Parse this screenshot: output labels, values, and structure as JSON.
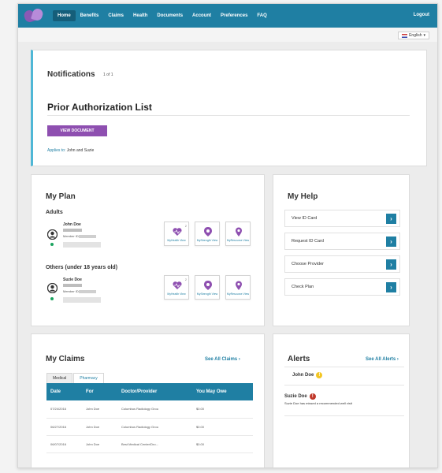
{
  "nav": {
    "items": [
      "Home",
      "Benefits",
      "Claims",
      "Health",
      "Documents",
      "Account",
      "Preferences",
      "FAQ"
    ],
    "active": "Home",
    "logout": "Logout"
  },
  "language": {
    "selected": "English"
  },
  "notifications": {
    "title": "Notifications",
    "count": "1 of 1",
    "item_title": "Prior Authorization List",
    "button": "VIEW DOCUMENT",
    "applies_label": "Applies to:",
    "applies_value": "John and Suzie"
  },
  "plan": {
    "title": "My Plan",
    "adults_heading": "Adults",
    "others_heading": "Others (under 18 years old)",
    "members": [
      {
        "name": "John Doe",
        "member_label": "Member ID:"
      },
      {
        "name": "Suzie Doe",
        "member_label": "Member ID:"
      }
    ],
    "tiles": [
      "MyHealth View",
      "MyStrength View",
      "MyResource View"
    ],
    "tile_badge": "2"
  },
  "help": {
    "title": "My Help",
    "items": [
      "View ID Card",
      "Request ID Card",
      "Choose Provider",
      "Check Plan"
    ]
  },
  "claims": {
    "title": "My Claims",
    "see_all": "See All Claims",
    "tabs": [
      "Medical",
      "Pharmacy"
    ],
    "columns": [
      "Date",
      "For",
      "Doctor/Provider",
      "You May Owe"
    ],
    "rows": [
      [
        "07/24/2016",
        "John Doe",
        "Columbus Radiology Grou",
        "$0.00"
      ],
      [
        "06/27/2016",
        "John Doe",
        "Columbus Radiology Grou",
        "$0.00"
      ],
      [
        "06/07/2016",
        "John Doe",
        "Best Medical Center/Dro...",
        "$0.00"
      ]
    ]
  },
  "alerts": {
    "title": "Alerts",
    "see_all": "See All Alerts",
    "items": [
      {
        "name": "John Doe",
        "icon": "!",
        "color": "#f3c623",
        "message": ""
      },
      {
        "name": "Suzie Doe",
        "icon": "!",
        "color": "#c0392b",
        "message": "Suzie Doe has missed a recommended well visit"
      }
    ]
  },
  "colors": {
    "primary": "#1f7fa3",
    "purple": "#8e4fb0",
    "accent": "#4fb7d6",
    "member_dot": "#1aa35f"
  }
}
